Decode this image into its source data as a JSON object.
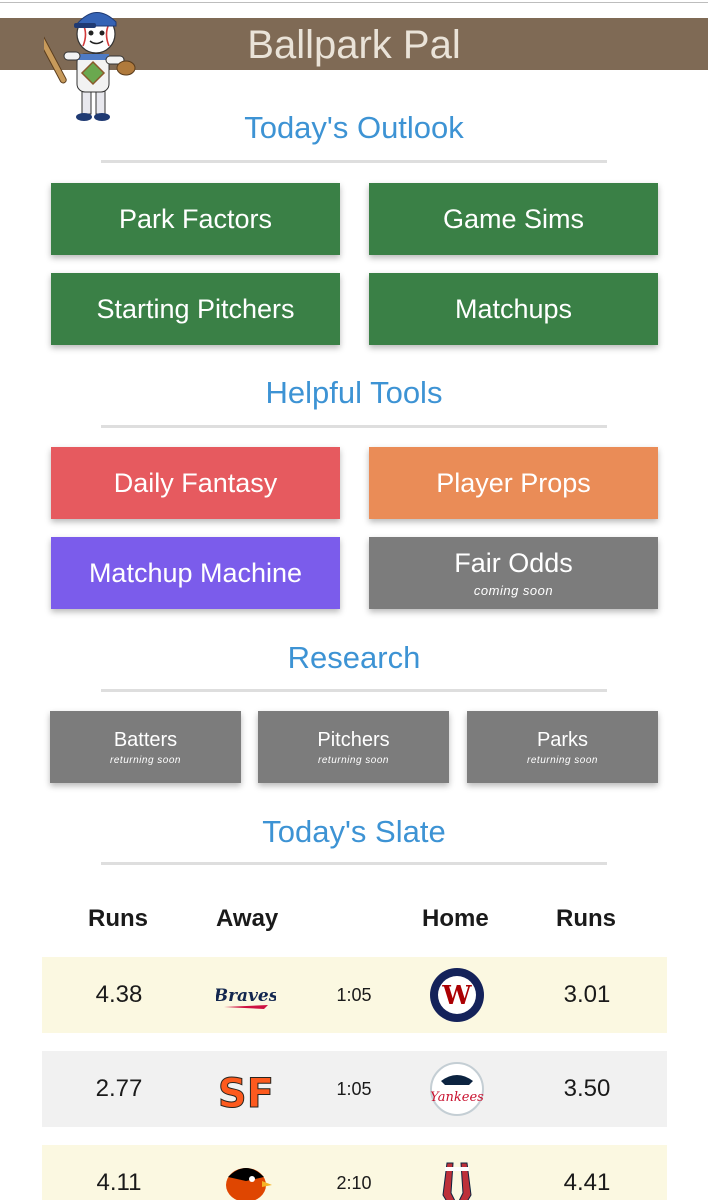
{
  "header": {
    "title": "Ballpark Pal"
  },
  "sections": {
    "outlook": {
      "title": "Today's Outlook"
    },
    "tools": {
      "title": "Helpful Tools"
    },
    "research": {
      "title": "Research"
    },
    "slate": {
      "title": "Today's Slate"
    }
  },
  "outlook_buttons": {
    "park_factors": "Park Factors",
    "game_sims": "Game Sims",
    "starting_pitchers": "Starting Pitchers",
    "matchups": "Matchups"
  },
  "tool_buttons": {
    "daily_fantasy": "Daily Fantasy",
    "player_props": "Player Props",
    "matchup_machine": "Matchup Machine",
    "fair_odds": "Fair Odds",
    "fair_odds_sub": "coming soon"
  },
  "research_buttons": {
    "batters": "Batters",
    "pitchers": "Pitchers",
    "parks": "Parks",
    "sub": "returning soon"
  },
  "slate": {
    "columns": {
      "runs_away": "Runs",
      "away": "Away",
      "home": "Home",
      "runs_home": "Runs"
    },
    "games": [
      {
        "away_runs": "4.38",
        "away_logo": "braves-logo",
        "time": "1:05",
        "home_logo": "nationals-logo",
        "home_runs": "3.01",
        "row_color": "#fbf8e1"
      },
      {
        "away_runs": "2.77",
        "away_logo": "giants-logo",
        "time": "1:05",
        "home_logo": "yankees-logo",
        "home_runs": "3.50",
        "row_color": "#f1f1f1"
      },
      {
        "away_runs": "4.11",
        "away_logo": "orioles-logo",
        "time": "2:10",
        "home_logo": "red-sox-logo",
        "home_runs": "4.41",
        "row_color": "#fbf8e1"
      }
    ]
  },
  "colors": {
    "header_bg": "#7f6a55",
    "section_title": "#3d93d4",
    "green": "#3a8046",
    "red": "#e65a5f",
    "orange": "#ea8c57",
    "purple": "#7b5ceb",
    "gray": "#7c7c7c"
  }
}
